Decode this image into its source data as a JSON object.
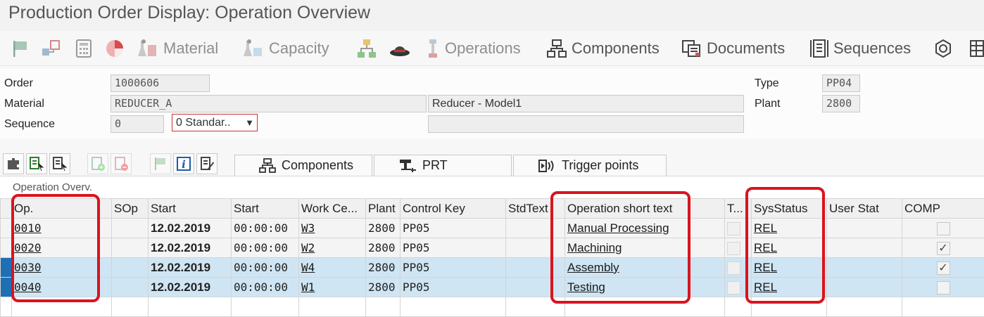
{
  "window": {
    "title": "Production Order Display: Operation Overview"
  },
  "toolbar": {
    "material_label": "Material",
    "capacity_label": "Capacity",
    "operations_label": "Operations",
    "components_label": "Components",
    "documents_label": "Documents",
    "sequences_label": "Sequences"
  },
  "header": {
    "order_label": "Order",
    "order_value": "1000606",
    "material_label": "Material",
    "material_value": "REDUCER_A",
    "material_desc": "Reducer - Model1",
    "sequence_label": "Sequence",
    "sequence_value": "0",
    "sequence_type": "0 Standar..",
    "type_label": "Type",
    "type_value": "PP04",
    "plant_label": "Plant",
    "plant_value": "2800"
  },
  "tabs": {
    "components": "Components",
    "prt": "PRT",
    "trigger_points": "Trigger points"
  },
  "table": {
    "caption": "Operation Overv.",
    "columns": [
      "Op.",
      "SOp",
      "Start",
      "Start",
      "Work Ce...",
      "Plant",
      "Control Key",
      "StdText",
      "Operation short text",
      "T...",
      "SysStatus",
      "User Stat",
      "COMP"
    ],
    "rows": [
      {
        "op": "0010",
        "sop": "",
        "date": "12.02.2019",
        "time": "00:00:00",
        "wc": "W3",
        "plant": "2800",
        "ck": "PP05",
        "std": "",
        "text": "Manual Processing",
        "sys": "REL",
        "user": "",
        "comp": ""
      },
      {
        "op": "0020",
        "sop": "",
        "date": "12.02.2019",
        "time": "00:00:00",
        "wc": "W2",
        "plant": "2800",
        "ck": "PP05",
        "std": "",
        "text": "Machining",
        "sys": "REL",
        "user": "",
        "comp": "✓"
      },
      {
        "op": "0030",
        "sop": "",
        "date": "12.02.2019",
        "time": "00:00:00",
        "wc": "W4",
        "plant": "2800",
        "ck": "PP05",
        "std": "",
        "text": "Assembly",
        "sys": "REL",
        "user": "",
        "comp": "✓"
      },
      {
        "op": "0040",
        "sop": "",
        "date": "12.02.2019",
        "time": "00:00:00",
        "wc": "W1",
        "plant": "2800",
        "ck": "PP05",
        "std": "",
        "text": "Testing",
        "sys": "REL",
        "user": "",
        "comp": ""
      }
    ]
  },
  "colors": {
    "highlight": "#d9141e",
    "selected_row": "#cfe5f3",
    "row_marker": "#1f6fb4"
  }
}
